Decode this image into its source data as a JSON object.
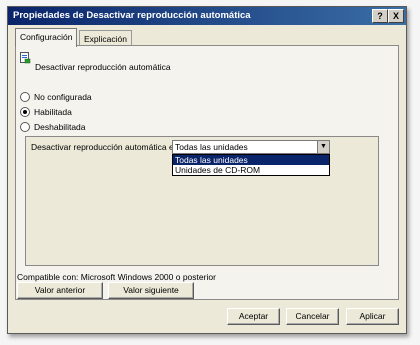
{
  "window": {
    "title": "Propiedades de Desactivar reproducción automática",
    "help_label": "?",
    "close_label": "X"
  },
  "tabs": [
    {
      "label": "Configuración",
      "active": true
    },
    {
      "label": "Explicación",
      "active": false
    }
  ],
  "policy": {
    "name": "Desactivar reproducción automática"
  },
  "radio_options": [
    {
      "label": "No configurada",
      "checked": false
    },
    {
      "label": "Habilitada",
      "checked": true
    },
    {
      "label": "Deshabilitada",
      "checked": false
    }
  ],
  "setting": {
    "label": "Desactivar reproducción automática en:",
    "selected": "Todas las unidades",
    "options": [
      "Todas las unidades",
      "Unidades de CD-ROM"
    ]
  },
  "compat": "Compatible con: Microsoft Windows 2000 o posterior",
  "nav_buttons": {
    "prev": "Valor anterior",
    "next": "Valor siguiente"
  },
  "dialog_buttons": {
    "ok": "Aceptar",
    "cancel": "Cancelar",
    "apply": "Aplicar"
  },
  "colors": {
    "titlebar_start": "#0a246a",
    "titlebar_end": "#3a6ea5",
    "selection": "#0a246a",
    "dialog_bg": "#ece9d8"
  }
}
